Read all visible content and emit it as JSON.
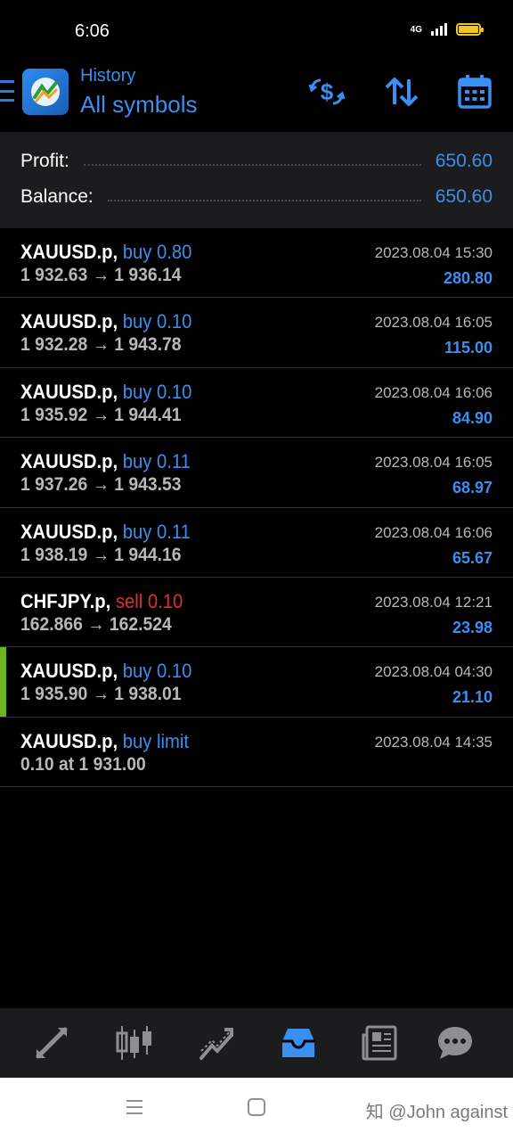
{
  "status": {
    "time": "6:06",
    "network": "4G"
  },
  "header": {
    "subtitle": "History",
    "title": "All symbols",
    "icons": [
      "menu-icon",
      "metatrader-logo",
      "dollar-exchange-icon",
      "sort-icon",
      "calendar-icon"
    ]
  },
  "summary": {
    "profit_label": "Profit:",
    "profit_value": "650.60",
    "balance_label": "Balance:",
    "balance_value": "650.60"
  },
  "trades": [
    {
      "symbol": "XAUUSD.p,",
      "type": "buy 0.80",
      "side": "buy",
      "prices": "1 932.63 → 1 936.14",
      "time": "2023.08.04 15:30",
      "profit": "280.80"
    },
    {
      "symbol": "XAUUSD.p,",
      "type": "buy 0.10",
      "side": "buy",
      "prices": "1 932.28 → 1 943.78",
      "time": "2023.08.04 16:05",
      "profit": "115.00"
    },
    {
      "symbol": "XAUUSD.p,",
      "type": "buy 0.10",
      "side": "buy",
      "prices": "1 935.92 → 1 944.41",
      "time": "2023.08.04 16:06",
      "profit": "84.90"
    },
    {
      "symbol": "XAUUSD.p,",
      "type": "buy 0.11",
      "side": "buy",
      "prices": "1 937.26 → 1 943.53",
      "time": "2023.08.04 16:05",
      "profit": "68.97"
    },
    {
      "symbol": "XAUUSD.p,",
      "type": "buy 0.11",
      "side": "buy",
      "prices": "1 938.19 → 1 944.16",
      "time": "2023.08.04 16:06",
      "profit": "65.67"
    },
    {
      "symbol": "CHFJPY.p,",
      "type": "sell 0.10",
      "side": "sell",
      "prices": "162.866 → 162.524",
      "time": "2023.08.04 12:21",
      "profit": "23.98"
    },
    {
      "symbol": "XAUUSD.p,",
      "type": "buy 0.10",
      "side": "buy",
      "prices": "1 935.90 → 1 938.01",
      "time": "2023.08.04 04:30",
      "profit": "21.10"
    },
    {
      "symbol": "XAUUSD.p,",
      "type": "buy limit",
      "side": "buy",
      "prices": "0.10 at 1 931.00",
      "time": "2023.08.04 14:35",
      "profit": ""
    }
  ],
  "bottom_nav": [
    "quotes-icon",
    "chart-icon",
    "trade-icon",
    "history-icon",
    "news-icon",
    "chat-icon"
  ],
  "active_tab": "history-icon",
  "colors": {
    "accent_blue": "#3a8ff0",
    "sell_red": "#e0322d",
    "marker_green": "#6eb520",
    "battery_yellow": "#f2c81e"
  },
  "watermark": "知 @John against"
}
